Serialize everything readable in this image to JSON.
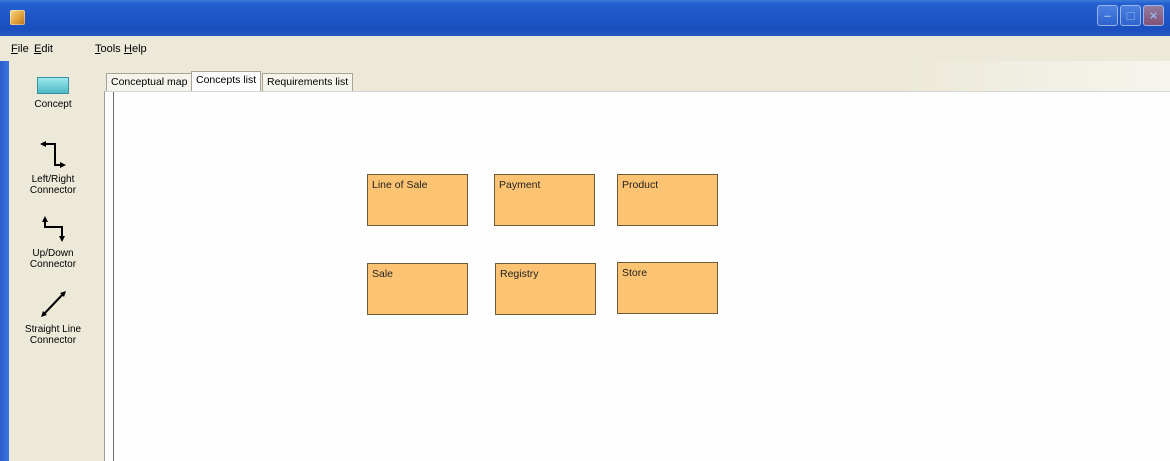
{
  "menu": {
    "file": "File",
    "edit": "Edit",
    "tools": "Tools",
    "help": "Help"
  },
  "toolbox": {
    "concept": "Concept",
    "left_right_line1": "Left/Right",
    "left_right_line2": "Connector",
    "up_down_line1": "Up/Down",
    "up_down_line2": "Connector",
    "straight_line1": "Straight Line",
    "straight_line2": "Connector"
  },
  "tabs": [
    "Conceptual map",
    "Concepts list",
    "Requirements list"
  ],
  "active_tab": "Concepts list",
  "concepts": [
    "Line of Sale",
    "Payment",
    "Product",
    "Sale",
    "Registry",
    "Store"
  ],
  "colors": {
    "concept_fill": "#fcc472",
    "title_bar": "#1e56c8"
  }
}
